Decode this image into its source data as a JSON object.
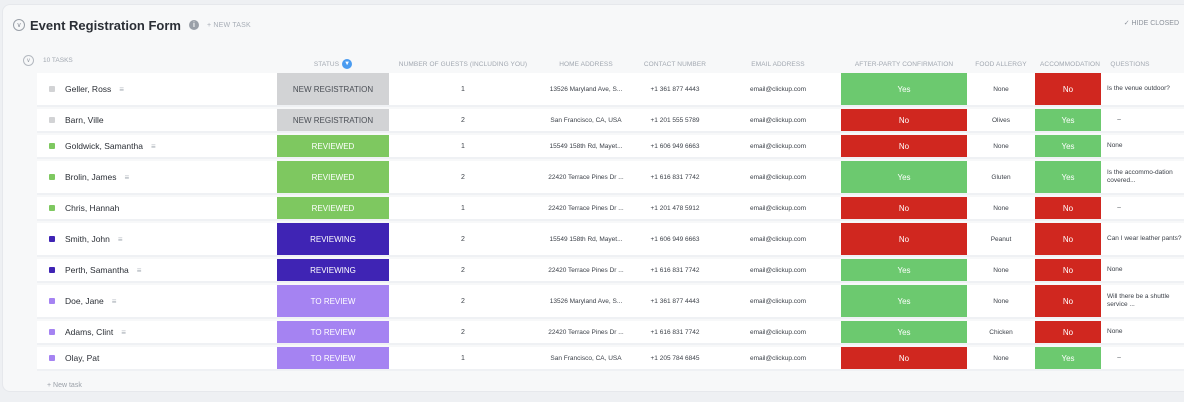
{
  "header": {
    "title": "Event Registration Form",
    "info": "i",
    "new_task": "+ NEW TASK",
    "hide_closed": "✓ HIDE CLOSED",
    "collapse": "∨"
  },
  "columns": {
    "tasks": "10 TASKS",
    "status": "STATUS",
    "guests": "NUMBER OF GUESTS (INCLUDING YOU)",
    "home": "HOME ADDRESS",
    "contact": "CONTACT NUMBER",
    "email": "EMAIL ADDRESS",
    "party": "AFTER-PARTY CONFIRMATION",
    "allergy": "FOOD ALLERGY",
    "accom": "ACCOMMODATION",
    "questions": "QUESTIONS"
  },
  "colors": {
    "new_registration": "#d2d3d5",
    "reviewed": "#7ec860",
    "reviewing": "#3f24b4",
    "to_review": "#a583f2",
    "yes": "#6cc96f",
    "no": "#d0271f"
  },
  "rows": [
    {
      "name": "Geller, Ross",
      "lines": true,
      "status": "NEW REGISTRATION",
      "status_key": "new_registration",
      "guests": "1",
      "home": "13526 Maryland Ave, S...",
      "contact": "+1 361 877 4443",
      "email": "email@clickup.com",
      "party": "Yes",
      "allergy": "None",
      "accom": "No",
      "question": "Is the venue outdoor?",
      "q_center": false
    },
    {
      "name": "Barn, Ville",
      "lines": false,
      "status": "NEW REGISTRATION",
      "status_key": "new_registration",
      "guests": "2",
      "home": "San Francisco, CA, USA",
      "contact": "+1 201 555 5789",
      "email": "email@clickup.com",
      "party": "No",
      "allergy": "Olives",
      "accom": "Yes",
      "question": "–",
      "q_center": true
    },
    {
      "name": "Goldwick, Samantha",
      "lines": true,
      "status": "REVIEWED",
      "status_key": "reviewed",
      "guests": "1",
      "home": "15549 158th Rd, Mayet...",
      "contact": "+1 606 949 6663",
      "email": "email@clickup.com",
      "party": "No",
      "allergy": "None",
      "accom": "Yes",
      "question": "None",
      "q_center": false
    },
    {
      "name": "Brolin, James",
      "lines": true,
      "status": "REVIEWED",
      "status_key": "reviewed",
      "guests": "2",
      "home": "22420 Terrace Pines Dr ...",
      "contact": "+1 616 831 7742",
      "email": "email@clickup.com",
      "party": "Yes",
      "allergy": "Gluten",
      "accom": "Yes",
      "question": "Is the accommo-dation covered...",
      "q_center": false
    },
    {
      "name": "Chris, Hannah",
      "lines": false,
      "status": "REVIEWED",
      "status_key": "reviewed",
      "guests": "1",
      "home": "22420 Terrace Pines Dr ...",
      "contact": "+1 201 478 5912",
      "email": "email@clickup.com",
      "party": "No",
      "allergy": "None",
      "accom": "No",
      "question": "–",
      "q_center": true
    },
    {
      "name": "Smith, John",
      "lines": true,
      "status": "REVIEWING",
      "status_key": "reviewing",
      "guests": "2",
      "home": "15549 158th Rd, Mayet...",
      "contact": "+1 606 949 6663",
      "email": "email@clickup.com",
      "party": "No",
      "allergy": "Peanut",
      "accom": "No",
      "question": "Can I wear leather pants?",
      "q_center": false
    },
    {
      "name": "Perth, Samantha",
      "lines": true,
      "status": "REVIEWING",
      "status_key": "reviewing",
      "guests": "2",
      "home": "22420 Terrace Pines Dr ...",
      "contact": "+1 616 831 7742",
      "email": "email@clickup.com",
      "party": "Yes",
      "allergy": "None",
      "accom": "No",
      "question": "None",
      "q_center": false
    },
    {
      "name": "Doe, Jane",
      "lines": true,
      "status": "TO REVIEW",
      "status_key": "to_review",
      "guests": "2",
      "home": "13526 Maryland Ave, S...",
      "contact": "+1 361 877 4443",
      "email": "email@clickup.com",
      "party": "Yes",
      "allergy": "None",
      "accom": "No",
      "question": "Will there be a shuttle service ...",
      "q_center": false
    },
    {
      "name": "Adams, Clint",
      "lines": true,
      "status": "TO REVIEW",
      "status_key": "to_review",
      "guests": "2",
      "home": "22420 Terrace Pines Dr ...",
      "contact": "+1 616 831 7742",
      "email": "email@clickup.com",
      "party": "Yes",
      "allergy": "Chicken",
      "accom": "No",
      "question": "None",
      "q_center": false
    },
    {
      "name": "Olay, Pat",
      "lines": false,
      "status": "TO REVIEW",
      "status_key": "to_review",
      "guests": "1",
      "home": "San Francisco, CA, USA",
      "contact": "+1 205 784 6845",
      "email": "email@clickup.com",
      "party": "No",
      "allergy": "None",
      "accom": "Yes",
      "question": "–",
      "q_center": true
    }
  ],
  "footer": {
    "new_task": "+ New task"
  }
}
